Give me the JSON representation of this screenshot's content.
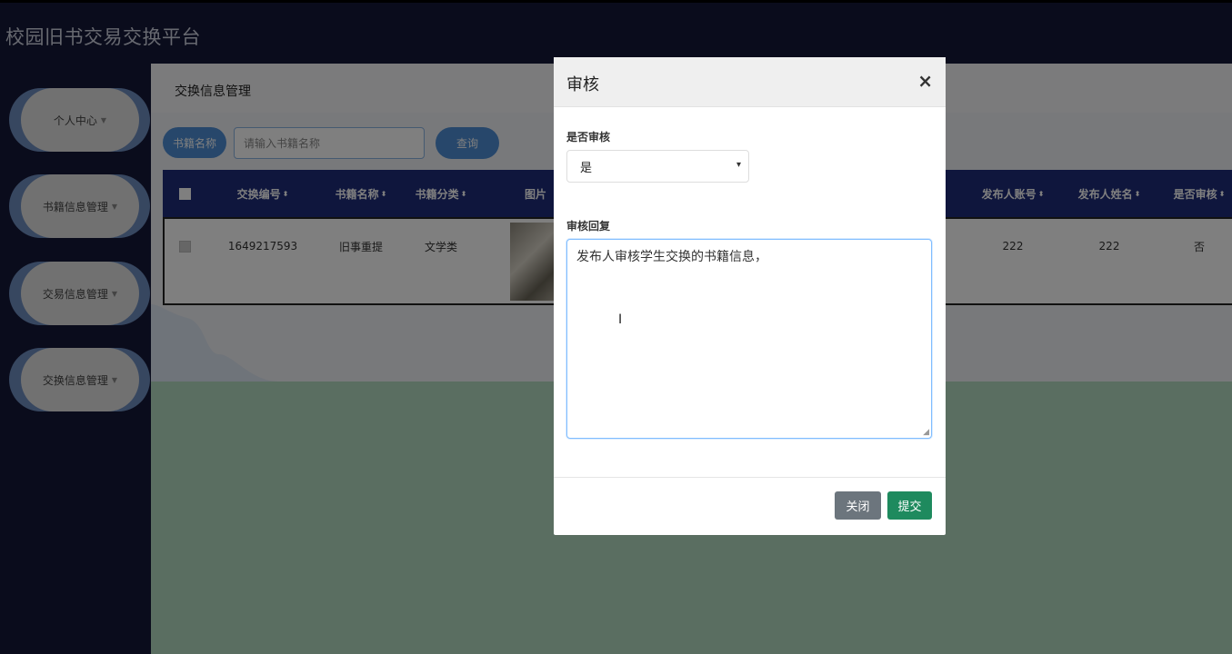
{
  "app": {
    "title": "校园旧书交易交换平台"
  },
  "sidebar": {
    "items": [
      {
        "label": "个人中心"
      },
      {
        "label": "书籍信息管理"
      },
      {
        "label": "交易信息管理"
      },
      {
        "label": "交换信息管理"
      }
    ]
  },
  "page": {
    "title": "交换信息管理"
  },
  "search": {
    "label": "书籍名称",
    "placeholder": "请输入书籍名称",
    "button": "查询"
  },
  "table": {
    "columns": [
      "交换编号",
      "书籍名称",
      "书籍分类",
      "图片",
      "发布人账号",
      "发布人姓名",
      "是否审核"
    ],
    "rows": [
      {
        "id": "1649217593",
        "name": "旧事重提",
        "category": "文学类",
        "account": "222",
        "publisher": "222",
        "reviewed": "否"
      }
    ]
  },
  "modal": {
    "title": "审核",
    "close_symbol": "×",
    "review_label": "是否审核",
    "review_value": "是",
    "reply_label": "审核回复",
    "reply_value": "发布人审核学生交换的书籍信息，",
    "close_button": "关闭",
    "submit_button": "提交"
  },
  "colors": {
    "header_bg": "#151838",
    "table_header": "#1f2c7a",
    "submit": "#1e8a5e",
    "close": "#6c757d",
    "pill_blue": "#4f8fd6"
  }
}
